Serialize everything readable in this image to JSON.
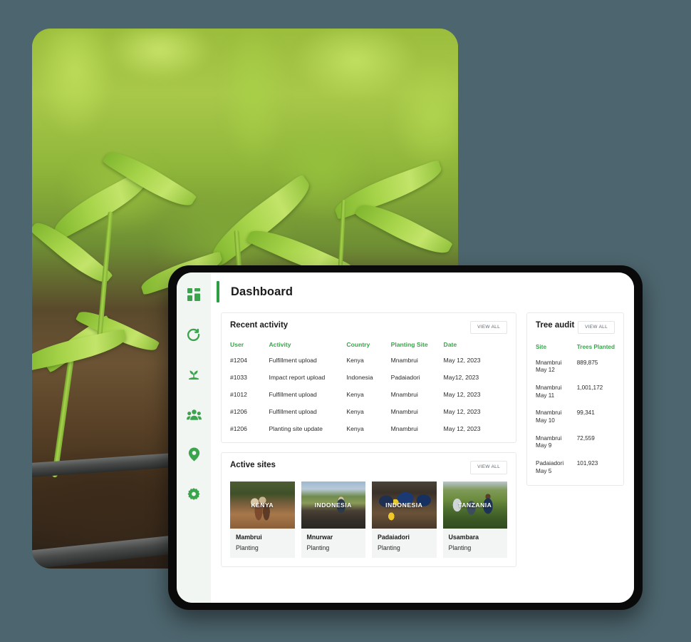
{
  "theme": {
    "page_background": "#4d656e",
    "accent_green": "#3aa54c",
    "active_bar_green": "#2e9e43",
    "sidebar_background": "#f2f6f2",
    "card_border": "#e8eae9"
  },
  "hero": {
    "alt": "close-up photo of green seedlings growing in dark soil"
  },
  "sidebar": {
    "items": [
      {
        "icon": "grid-dashboard-icon",
        "name": "dashboard",
        "active": true
      },
      {
        "icon": "refresh-cycle-icon",
        "name": "cycle",
        "active": false
      },
      {
        "icon": "seedling-icon",
        "name": "planting",
        "active": false
      },
      {
        "icon": "people-group-icon",
        "name": "teams",
        "active": false
      },
      {
        "icon": "location-pin-icon",
        "name": "sites",
        "active": false
      },
      {
        "icon": "gear-icon",
        "name": "settings",
        "active": false
      }
    ]
  },
  "header": {
    "title": "Dashboard"
  },
  "recent_activity": {
    "title": "Recent activity",
    "view_all_label": "VIEW ALL",
    "columns": [
      "User",
      "Activity",
      "Country",
      "Planting Site",
      "Date"
    ],
    "rows": [
      {
        "user": "#1204",
        "activity": "Fulfillment upload",
        "country": "Kenya",
        "site": "Mnambrui",
        "date": "May 12, 2023"
      },
      {
        "user": "#1033",
        "activity": "Impact report upload",
        "country": "Indonesia",
        "site": "Padaiadori",
        "date": "May12, 2023"
      },
      {
        "user": "#1012",
        "activity": "Fulfillment upload",
        "country": "Kenya",
        "site": "Mnambrui",
        "date": "May 12, 2023"
      },
      {
        "user": "#1206",
        "activity": "Fulfillment upload",
        "country": "Kenya",
        "site": "Mnambrui",
        "date": "May 12, 2023"
      },
      {
        "user": "#1206",
        "activity": "Planting site update",
        "country": "Kenya",
        "site": "Mnambrui",
        "date": "May 12, 2023"
      }
    ]
  },
  "tree_audit": {
    "title": "Tree audit",
    "view_all_label": "VIEW ALL",
    "columns": [
      "Site",
      "Trees Planted"
    ],
    "rows": [
      {
        "site": "Mnambrui",
        "date": "May 12",
        "trees": "889,875"
      },
      {
        "site": "Mnambrui",
        "date": "May 11",
        "trees": "1,001,172"
      },
      {
        "site": "Mnambrui",
        "date": "May 10",
        "trees": "99,341"
      },
      {
        "site": "Mnambrui",
        "date": "May 9",
        "trees": "72,559"
      },
      {
        "site": "Padaiadori",
        "date": "May 5",
        "trees": "101,923"
      }
    ]
  },
  "active_sites": {
    "title": "Active sites",
    "view_all_label": "VIEW ALL",
    "cards": [
      {
        "country": "KENYA",
        "name": "Mambrui",
        "status": "Planting",
        "scene": "scene-kenya"
      },
      {
        "country": "INDONESIA",
        "name": "Mnurwar",
        "status": "Planting",
        "scene": "scene-indonesia1"
      },
      {
        "country": "INDONESIA",
        "name": "Padaiadori",
        "status": "Planting",
        "scene": "scene-indonesia2"
      },
      {
        "country": "TANZANIA",
        "name": "Usambara",
        "status": "Planting",
        "scene": "scene-tanzania"
      }
    ]
  }
}
